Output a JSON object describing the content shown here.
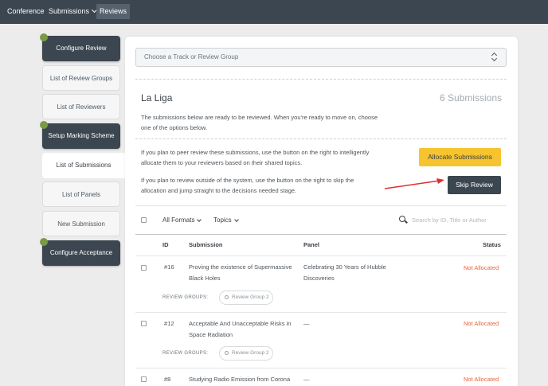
{
  "topnav": {
    "conference": "Conference",
    "submissions": "Submissions",
    "reviews": "Reviews"
  },
  "sidebar": {
    "items": [
      {
        "label": "Configure Review"
      },
      {
        "label": "List of Review Groups"
      },
      {
        "label": "List of Reviewers"
      },
      {
        "label": "Setup Marking Scheme"
      },
      {
        "label": "List of Submissions"
      },
      {
        "label": "List of Panels"
      },
      {
        "label": "New Submission"
      },
      {
        "label": "Configure Acceptance"
      }
    ]
  },
  "track_select": {
    "placeholder": "Choose a Track or Review Group"
  },
  "main": {
    "title": "La Liga",
    "count": "6 Submissions",
    "intro": "The submissions below are ready to be reviewed. When you're ready to move on, choose one of the options below.",
    "peer_text": "If you plan to peer review these submissions, use the button on the right to intelligently allocate them to your reviewers based on their shared topics.",
    "skip_text": "If you plan to review outside of the system, use the button on the right to skip the allocation and jump straight to the decisions needed stage.",
    "allocate_label": "Allocate Submissions",
    "skip_label": "Skip Review"
  },
  "filters": {
    "formats": "All Formats",
    "topics": "Topics",
    "search_placeholder": "Search by ID, Title or Author"
  },
  "table": {
    "headers": {
      "id": "ID",
      "submission": "Submission",
      "panel": "Panel",
      "status": "Status"
    },
    "review_groups_label": "REVIEW GROUPS:",
    "rows": [
      {
        "id": "#16",
        "submission": "Proving the existence of Supermassive Black Holes",
        "panel": "Celebrating 30 Years of Hubble Discoveries",
        "status": "Not Allocated",
        "review_group": "Review Group 2"
      },
      {
        "id": "#12",
        "submission": "Acceptable And Unacceptable Risks in Space Radiation",
        "panel": "—",
        "status": "Not Allocated",
        "review_group": "Review Group 2"
      },
      {
        "id": "#8",
        "submission": "Studying Radio Emission from Corona",
        "panel": "—",
        "status": "Not Allocated"
      }
    ]
  },
  "colors": {
    "topbar": "#3b4650",
    "accent_yellow": "#f6c42f",
    "status_orange": "#e8663a",
    "done_dot": "#7a9a43",
    "arrow_red": "#e02f2f"
  }
}
